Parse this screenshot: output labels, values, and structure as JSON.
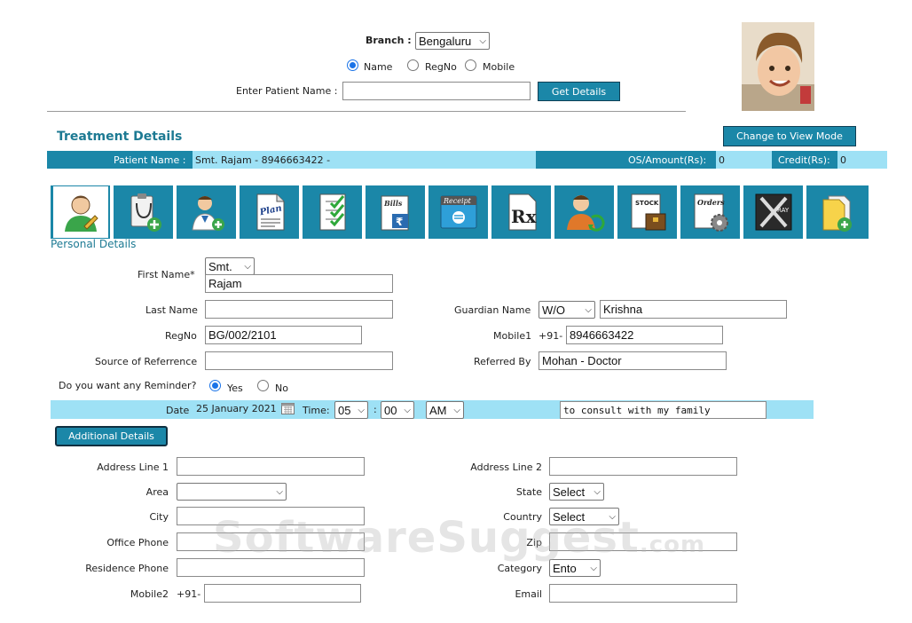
{
  "search": {
    "branch_label": "Branch :",
    "branch_value": "Bengaluru",
    "search_by": [
      "Name",
      "RegNo",
      "Mobile"
    ],
    "search_selected": "Name",
    "enter_label": "Enter Patient Name :",
    "patient_name_value": "",
    "get_details_label": "Get Details"
  },
  "header": {
    "title": "Treatment Details",
    "change_mode_label": "Change to View Mode",
    "patient_name_label": "Patient Name :",
    "patient_name_value": "Smt. Rajam - 8946663422 -",
    "os_amount_label": "OS/Amount(Rs):",
    "os_amount_value": "0",
    "credit_label": "Credit(Rs):",
    "credit_value": "0"
  },
  "toolbar": {
    "icons": [
      {
        "name": "patient-profile-icon"
      },
      {
        "name": "clipboard-stethoscope-icon"
      },
      {
        "name": "add-doctor-icon"
      },
      {
        "name": "plan-icon",
        "text": "Plan"
      },
      {
        "name": "checklist-icon"
      },
      {
        "name": "bills-icon",
        "text": "Bills"
      },
      {
        "name": "receipt-icon",
        "text": "Receipt"
      },
      {
        "name": "prescription-icon",
        "text": "Rx"
      },
      {
        "name": "patient-refresh-icon"
      },
      {
        "name": "stock-icon",
        "text": "STOCK"
      },
      {
        "name": "orders-icon",
        "text": "Orders"
      },
      {
        "name": "xray-icon",
        "text": "RAY"
      },
      {
        "name": "add-document-icon"
      }
    ]
  },
  "personal": {
    "section_label": "Personal Details",
    "first_name_label": "First Name*",
    "title_value": "Smt.",
    "first_name_value": "Rajam",
    "last_name_label": "Last Name",
    "last_name_value": "",
    "guardian_label": "Guardian Name",
    "guardian_rel_value": "W/O",
    "guardian_name_value": "Krishna",
    "regno_label": "RegNo",
    "regno_value": "BG/002/2101",
    "mobile1_label": "Mobile1",
    "mobile1_prefix": "+91-",
    "mobile1_value": "8946663422",
    "source_label": "Source of Referrence",
    "source_value": "",
    "referred_label": "Referred By",
    "referred_value": "Mohan - Doctor",
    "reminder_label": "Do you want any Reminder?",
    "reminder_yes": "Yes",
    "reminder_no": "No",
    "reminder_selected": "Yes"
  },
  "reminder": {
    "date_label": "Date",
    "date_value": "25 January 2021",
    "time_label": "Time:",
    "hour_value": "05",
    "sep": ":",
    "minute_value": "00",
    "ampm_value": "AM",
    "note_value": "to consult with my family"
  },
  "additional": {
    "button_label": "Additional Details",
    "address1_label": "Address Line 1",
    "address1_value": "",
    "address2_label": "Address Line 2",
    "address2_value": "",
    "area_label": "Area",
    "area_value": "",
    "state_label": "State",
    "state_value": "Select",
    "city_label": "City",
    "city_value": "",
    "country_label": "Country",
    "country_value": "Select",
    "office_label": "Office Phone",
    "office_value": "",
    "zip_label": "Zip",
    "zip_value": "",
    "residence_label": "Residence Phone",
    "residence_value": "",
    "category_label": "Category",
    "category_value": "Ento",
    "mobile2_label": "Mobile2",
    "mobile2_prefix": "+91-",
    "mobile2_value": "",
    "email_label": "Email",
    "email_value": ""
  },
  "watermark": {
    "main": "SoftwareSuggest",
    "suffix": ".com"
  },
  "colors": {
    "teal": "#1b87a8",
    "light_blue": "#9ee1f5",
    "title_teal": "#1d7a93",
    "radio_blue": "#1a73e8"
  }
}
